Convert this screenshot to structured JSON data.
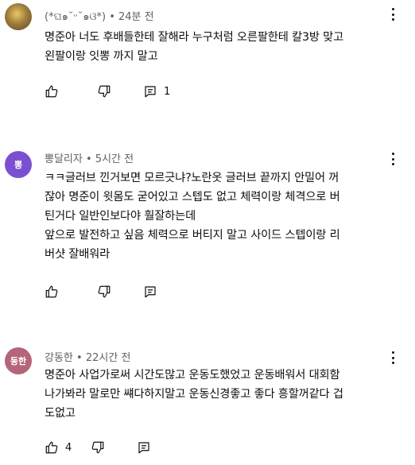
{
  "comments": [
    {
      "author": "(*ଘ๑˘ᵕ˘๑ଓ*)",
      "time": "24분 전",
      "avatar_text": "",
      "avatar_color": "#8a7a4a",
      "lines": [
        "명준아 너도 후배들한테 잘해라 누구처럼 오른팔한테 칼3방 맞고",
        "왼팔이랑 잇뽕 까지 말고"
      ],
      "like_count": "",
      "reply_count": "1"
    },
    {
      "author": "뽕달리자",
      "time": "5시간 전",
      "avatar_text": "뽕",
      "avatar_color": "#7b4fd1",
      "lines": [
        "ㅋㅋ글러브 낀거보면 모르긋냐?노란옷 글러브  끝까지 안밀어 꺼",
        "잖아 명준이 윗몸도 굳어있고 스텝도 없고 체력이랑 체격으로 버",
        "틴거다 일반인보다야 훨잘하는데",
        "앞으로 발전하고 싶음 체력으로 버티지 말고 사이드 스텝이랑 리",
        "버샷 잘배워라"
      ],
      "like_count": "",
      "reply_count": ""
    },
    {
      "author": "강동한",
      "time": "22시간 전",
      "avatar_text": "동한",
      "avatar_color": "#b5657a",
      "lines": [
        "명준아 사업가로써 시간도많고 운동도했었고 운동배워서 대회함",
        "나가봐라 말로만 썌다하지말고 운동신경좋고 좋다 흥할꺼같다 겁",
        "도없고"
      ],
      "like_count": "4",
      "reply_count": ""
    }
  ],
  "separator": "•",
  "icons": [
    "thumbs-up-icon",
    "thumbs-down-icon",
    "reply-icon",
    "more-vert-icon"
  ]
}
